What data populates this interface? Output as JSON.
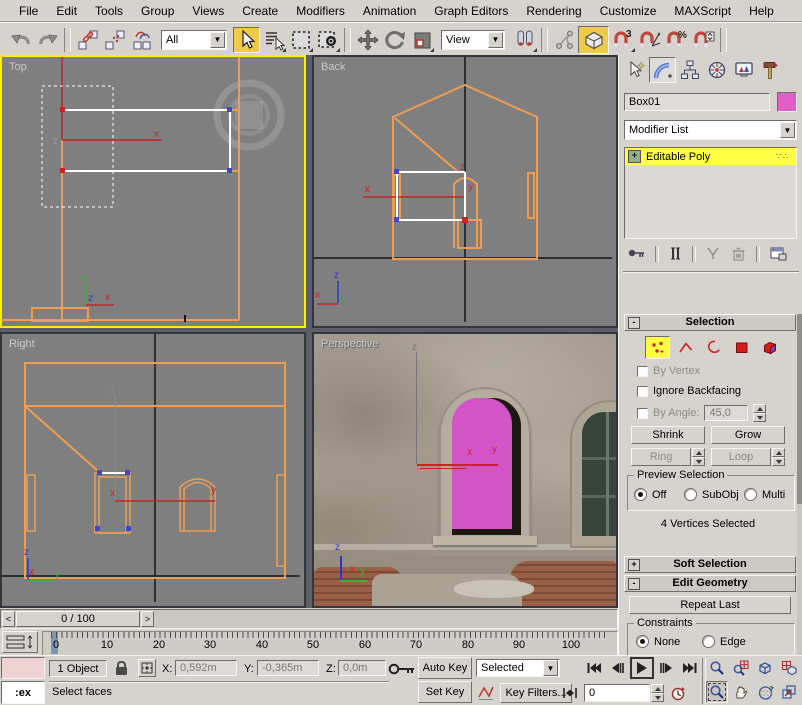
{
  "menu": {
    "items": [
      "File",
      "Edit",
      "Tools",
      "Group",
      "Views",
      "Create",
      "Modifiers",
      "Animation",
      "Graph Editors",
      "Rendering",
      "Customize",
      "MAXScript",
      "Help"
    ]
  },
  "toolbar": {
    "selection_filter": "All",
    "coord_system": "View"
  },
  "viewports": {
    "top_label": "Top",
    "back_label": "Back",
    "right_label": "Right",
    "perspective_label": "Perspective"
  },
  "axis": {
    "x": "x",
    "y": "y",
    "z": "z"
  },
  "panel": {
    "object_name": "Box01",
    "modifier_list": "Modifier List",
    "stack_item": "Editable Poly",
    "stack_expand": "+",
    "rollouts": {
      "selection_state": "-",
      "selection_title": "Selection",
      "soft_state": "+",
      "soft_title": "Soft Selection",
      "editgeo_state": "-",
      "editgeo_title": "Edit Geometry"
    },
    "selection": {
      "by_vertex": "By Vertex",
      "ignore_backfacing": "Ignore Backfacing",
      "by_angle": "By Angle:",
      "by_angle_value": "45,0",
      "shrink": "Shrink",
      "grow": "Grow",
      "ring": "Ring",
      "loop": "Loop",
      "preview_title": "Preview Selection",
      "preview_off": "Off",
      "preview_subobj": "SubObj",
      "preview_multi": "Multi",
      "status": "4 Vertices Selected"
    },
    "edit_geometry": {
      "repeat_last": "Repeat Last",
      "constraints": "Constraints",
      "none": "None",
      "edge": "Edge"
    }
  },
  "timeline": {
    "slider_value": "0 / 100",
    "prev": "<",
    "next": ">",
    "ticks": [
      "0",
      "10",
      "20",
      "30",
      "40",
      "50",
      "60",
      "70",
      "80",
      "90",
      "100"
    ]
  },
  "status": {
    "listener_text": ":ex",
    "object_count": "1 Object",
    "x_label": "X:",
    "x_value": "0,592m",
    "y_label": "Y:",
    "y_value": "-0,365m",
    "z_label": "Z:",
    "z_value": "0,0m",
    "prompt": "Select faces",
    "auto_key": "Auto Key",
    "set_key": "Set Key",
    "key_filters": "Key Filters...",
    "anim_set": "Selected",
    "frame_value": "0"
  },
  "icons": {
    "dropdown_arrow": "▼"
  },
  "colors": {
    "ui_face": "#d6d3ce",
    "viewport_background": "#7f7f7f",
    "active_viewport_border": "#ffee00",
    "wireframe_orange": "#ee9d55",
    "selected_edge": "#ffffff",
    "selected_vertex": "#cc2222",
    "unselected_vertex": "#4444cc",
    "selected_face_magenta": "#d254c6",
    "object_color_swatch": "#e060c8",
    "modifier_highlight": "#ffff45",
    "toolbar_highlight": "#eec94a"
  }
}
